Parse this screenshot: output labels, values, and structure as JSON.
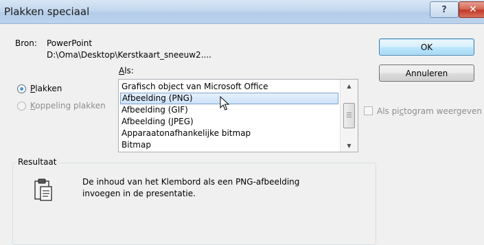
{
  "window": {
    "title": "Plakken speciaal",
    "help_glyph": "?",
    "close_glyph": "✕"
  },
  "source": {
    "label": "Bron:",
    "app": "PowerPoint",
    "path": "D:\\Oma\\Desktop\\Kerstkaart_sneeuw2...."
  },
  "as_label_prefix": "A",
  "as_label_rest": "ls:",
  "options": {
    "paste_underline": "P",
    "paste_rest": "lakken",
    "link_underline": "K",
    "link_rest": "oppeling plakken"
  },
  "list": {
    "items": [
      "Grafisch object van Microsoft Office",
      "Afbeelding (PNG)",
      "Afbeelding (GIF)",
      "Afbeelding (JPEG)",
      "Apparaatonafhankelijke bitmap",
      "Bitmap"
    ],
    "selected": "Afbeelding (PNG)"
  },
  "buttons": {
    "ok": "OK",
    "cancel": "Annuleren"
  },
  "icon_checkbox": {
    "pre": "Als pi",
    "underline": "c",
    "post": "togram weergeven"
  },
  "result": {
    "title": "Resultaat",
    "line1": "De inhoud van het Klembord als een PNG-afbeelding",
    "line2": "invoegen in de presentatie."
  },
  "icons": [
    "help-icon",
    "close-icon",
    "clipboard-icon",
    "scroll-up-icon",
    "scroll-down-icon",
    "mouse-cursor-icon"
  ]
}
